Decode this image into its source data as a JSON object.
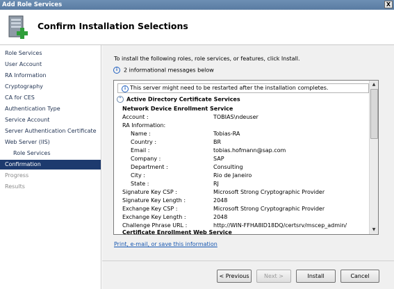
{
  "window": {
    "title": "Add Role Services",
    "close_label": "X"
  },
  "header": {
    "title": "Confirm Installation Selections"
  },
  "sidebar": {
    "items": [
      {
        "label": "Role Services",
        "state": "normal"
      },
      {
        "label": "User Account",
        "state": "normal"
      },
      {
        "label": "RA Information",
        "state": "normal"
      },
      {
        "label": "Cryptography",
        "state": "normal"
      },
      {
        "label": "CA for CES",
        "state": "normal"
      },
      {
        "label": "Authentication Type",
        "state": "normal"
      },
      {
        "label": "Service Account",
        "state": "normal"
      },
      {
        "label": "Server Authentication Certificate",
        "state": "normal"
      },
      {
        "label": "Web Server (IIS)",
        "state": "normal"
      },
      {
        "label": "Role Services",
        "state": "indent"
      },
      {
        "label": "Confirmation",
        "state": "active"
      },
      {
        "label": "Progress",
        "state": "dim"
      },
      {
        "label": "Results",
        "state": "dim"
      }
    ]
  },
  "main": {
    "intro": "To install the following roles, role services, or features, click Install.",
    "info_messages": "2 informational messages below",
    "warning": "This server might need to be restarted after the installation completes.",
    "section_title": "Active Directory Certificate Services",
    "ndes_title": "Network Device Enrollment Service",
    "account_label": "Account :",
    "account_value": "TOBIAS\\ndeuser",
    "ra_info_label": "RA Information:",
    "ra_fields": [
      {
        "label": "Name :",
        "value": "Tobias-RA"
      },
      {
        "label": "Country :",
        "value": "BR"
      },
      {
        "label": "Email :",
        "value": "tobias.hofmann@sap.com"
      },
      {
        "label": "Company :",
        "value": "SAP"
      },
      {
        "label": "Department :",
        "value": "Consulting"
      },
      {
        "label": "City :",
        "value": "Rio de Janeiro"
      },
      {
        "label": "State :",
        "value": "RJ"
      }
    ],
    "key_fields": [
      {
        "label": "Signature Key CSP :",
        "value": "Microsoft Strong Cryptographic Provider"
      },
      {
        "label": "Signature Key Length :",
        "value": "2048"
      },
      {
        "label": "Exchange Key CSP :",
        "value": "Microsoft Strong Cryptographic Provider"
      },
      {
        "label": "Exchange Key Length :",
        "value": "2048"
      },
      {
        "label": "Challenge Phrase URL :",
        "value": "http://WIN-FFHA8ID18DQ/certsrv/mscep_admin/"
      }
    ],
    "ces_title": "Certificate Enrollment Web Service",
    "print_link": "Print, e-mail, or save this information"
  },
  "buttons": {
    "previous": "< Previous",
    "next": "Next >",
    "install": "Install",
    "cancel": "Cancel"
  }
}
